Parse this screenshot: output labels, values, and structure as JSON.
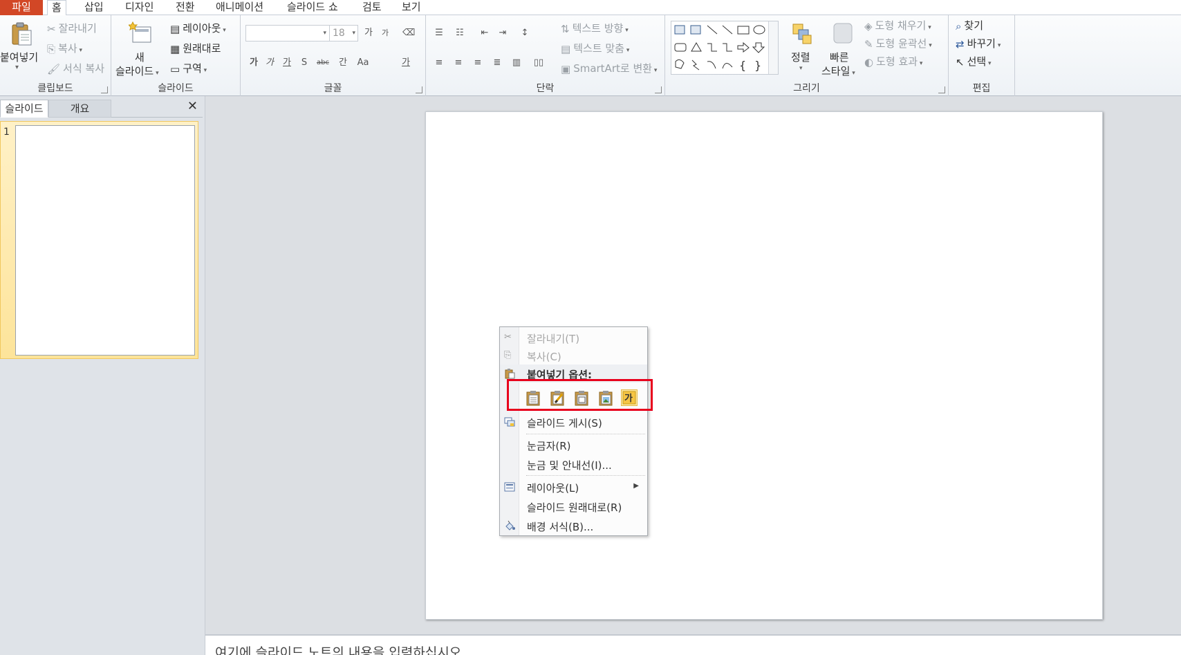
{
  "tabs": [
    {
      "label": "파일"
    },
    {
      "label": "홈"
    },
    {
      "label": "삽입"
    },
    {
      "label": "디자인"
    },
    {
      "label": "전환"
    },
    {
      "label": "애니메이션"
    },
    {
      "label": "슬라이드 쇼"
    },
    {
      "label": "검토"
    },
    {
      "label": "보기"
    }
  ],
  "ribbon": {
    "clipboard": {
      "paste": "붙여넣기",
      "cut": "잘라내기",
      "copy": "복사",
      "format_painter": "서식 복사",
      "group": "클립보드"
    },
    "slides": {
      "new_slide_1": "새",
      "new_slide_2": "슬라이드",
      "layout": "레이아웃",
      "reset": "원래대로",
      "section": "구역",
      "group": "슬라이드"
    },
    "font": {
      "font_size": "18",
      "group": "글꼴",
      "icons": [
        "가",
        "가",
        "가",
        "S",
        "abc",
        "간",
        "Aa",
        "가"
      ]
    },
    "paragraph": {
      "text_direction": "텍스트 방향",
      "align_text": "텍스트 맞춤",
      "smartart": "SmartArt로 변환",
      "group": "단락"
    },
    "drawing": {
      "arrange": "정렬",
      "quick_1": "빠른",
      "quick_2": "스타일",
      "fill": "도형 채우기",
      "outline": "도형 윤곽선",
      "effect": "도형 효과",
      "group": "그리기"
    },
    "editing": {
      "find": "찾기",
      "replace": "바꾸기",
      "select": "선택",
      "group": "편집"
    }
  },
  "left_panel": {
    "tab_slides": "슬라이드",
    "tab_outline": "개요",
    "close": "✕",
    "slide_number": "1"
  },
  "notes_placeholder": "여기에 슬라이드 노트의 내용을 입력하십시오",
  "context_menu": {
    "cut": "잘라내기(T)",
    "copy": "복사(C)",
    "paste_options": "붙여넣기 옵션:",
    "paste_text_icon": "가",
    "publish": "슬라이드 게시(S)",
    "ruler": "눈금자(R)",
    "grid": "눈금 및 안내선(I)...",
    "layout": "레이아웃(L)",
    "reset": "슬라이드 원래대로(R)",
    "background": "배경 서식(B)..."
  },
  "colors": {
    "file_tab": "#d24726",
    "highlight_box": "#e8001c",
    "selected_thumb": "#fde49a"
  }
}
